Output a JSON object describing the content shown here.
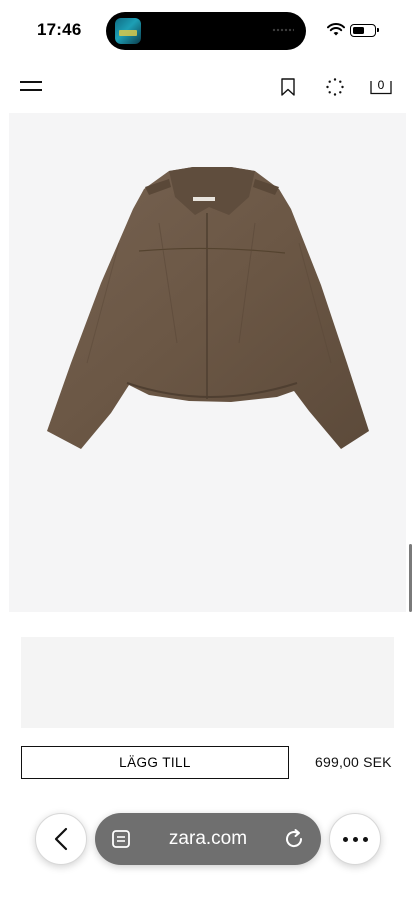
{
  "status_bar": {
    "time": "17:46"
  },
  "nav": {
    "bag_count": "0"
  },
  "product": {
    "image_alt": "brown suede cropped jacket",
    "add_label": "LÄGG TILL",
    "price": "699,00 SEK"
  },
  "browser": {
    "url": "zara.com"
  },
  "colors": {
    "jacket": "#6b5745",
    "image_bg": "#f5f5f6",
    "url_bar": "#6f6f6f"
  },
  "icons": [
    "menu-icon",
    "bookmark-icon",
    "loader-icon",
    "bag-icon",
    "back-icon",
    "tabs-icon",
    "reload-icon",
    "more-icon",
    "wifi-icon",
    "battery-icon"
  ]
}
